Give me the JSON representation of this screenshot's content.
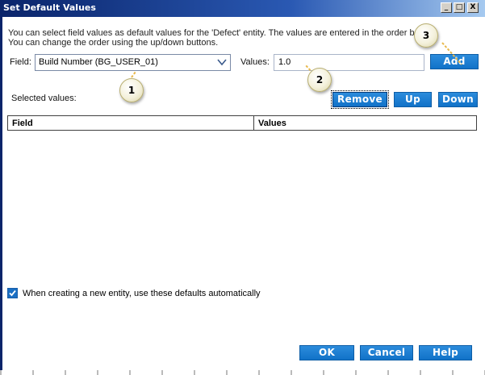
{
  "window": {
    "title": "Set Default Values",
    "controls": {
      "minimize": "_",
      "maximize": "□",
      "close": "X"
    }
  },
  "description": {
    "line1": "You can select field values as default values for the 'Defect' entity. The values are entered in the order below.",
    "line2": "You can change the order using the up/down buttons."
  },
  "field": {
    "label": "Field:",
    "value": "Build Number (BG_USER_01)"
  },
  "values": {
    "label": "Values:",
    "value": "1.0"
  },
  "buttons": {
    "add": "Add",
    "remove": "Remove",
    "up": "Up",
    "down": "Down",
    "ok": "OK",
    "cancel": "Cancel",
    "help": "Help"
  },
  "selected_label": "Selected values:",
  "table": {
    "columns": [
      "Field",
      "Values"
    ],
    "rows": []
  },
  "auto_defaults": {
    "checked": true,
    "label": "When creating a new entity, use these defaults automatically"
  },
  "callouts": [
    "1",
    "2",
    "3"
  ],
  "colors": {
    "button_blue": "#1a7fd4",
    "title_bar": "#0a246a",
    "checkbox": "#1a6fc4"
  }
}
